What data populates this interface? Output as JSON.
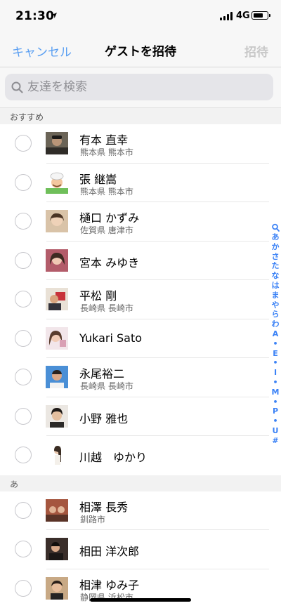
{
  "status_bar": {
    "time": "21:30",
    "network": "4G"
  },
  "nav": {
    "cancel_label": "キャンセル",
    "title": "ゲストを招待",
    "invite_label": "招待"
  },
  "search": {
    "placeholder": "友達を検索"
  },
  "sections": [
    {
      "header": "おすすめ"
    },
    {
      "header": "あ"
    }
  ],
  "recommended": [
    {
      "name": "有本 直幸",
      "location": "熊本県 熊本市"
    },
    {
      "name": "張 継嵩",
      "location": "熊本県 熊本市"
    },
    {
      "name": "樋口 かずみ",
      "location": "佐賀県 唐津市"
    },
    {
      "name": "宮本 みゆき",
      "location": ""
    },
    {
      "name": "平松 剛",
      "location": "長崎県 長崎市"
    },
    {
      "name": "Yukari Sato",
      "location": ""
    },
    {
      "name": "永尾裕二",
      "location": "長崎県 長崎市"
    },
    {
      "name": "小野 雅也",
      "location": ""
    },
    {
      "name": "川越　ゆかり",
      "location": ""
    }
  ],
  "a_section": [
    {
      "name": "相澤 長秀",
      "location": "釧路市"
    },
    {
      "name": "相田 洋次郎",
      "location": ""
    },
    {
      "name": "相津 ゆみ子",
      "location": "静岡県 浜松市"
    }
  ],
  "index_bar": [
    "あ",
    "か",
    "さ",
    "た",
    "な",
    "は",
    "ま",
    "や",
    "ら",
    "わ",
    "A",
    "•",
    "E",
    "•",
    "I",
    "•",
    "M",
    "•",
    "P",
    "•",
    "U",
    "#"
  ],
  "colors": {
    "accent": "#5a9ff2",
    "index": "#3b82f6",
    "disabled": "#c8c8c8"
  }
}
